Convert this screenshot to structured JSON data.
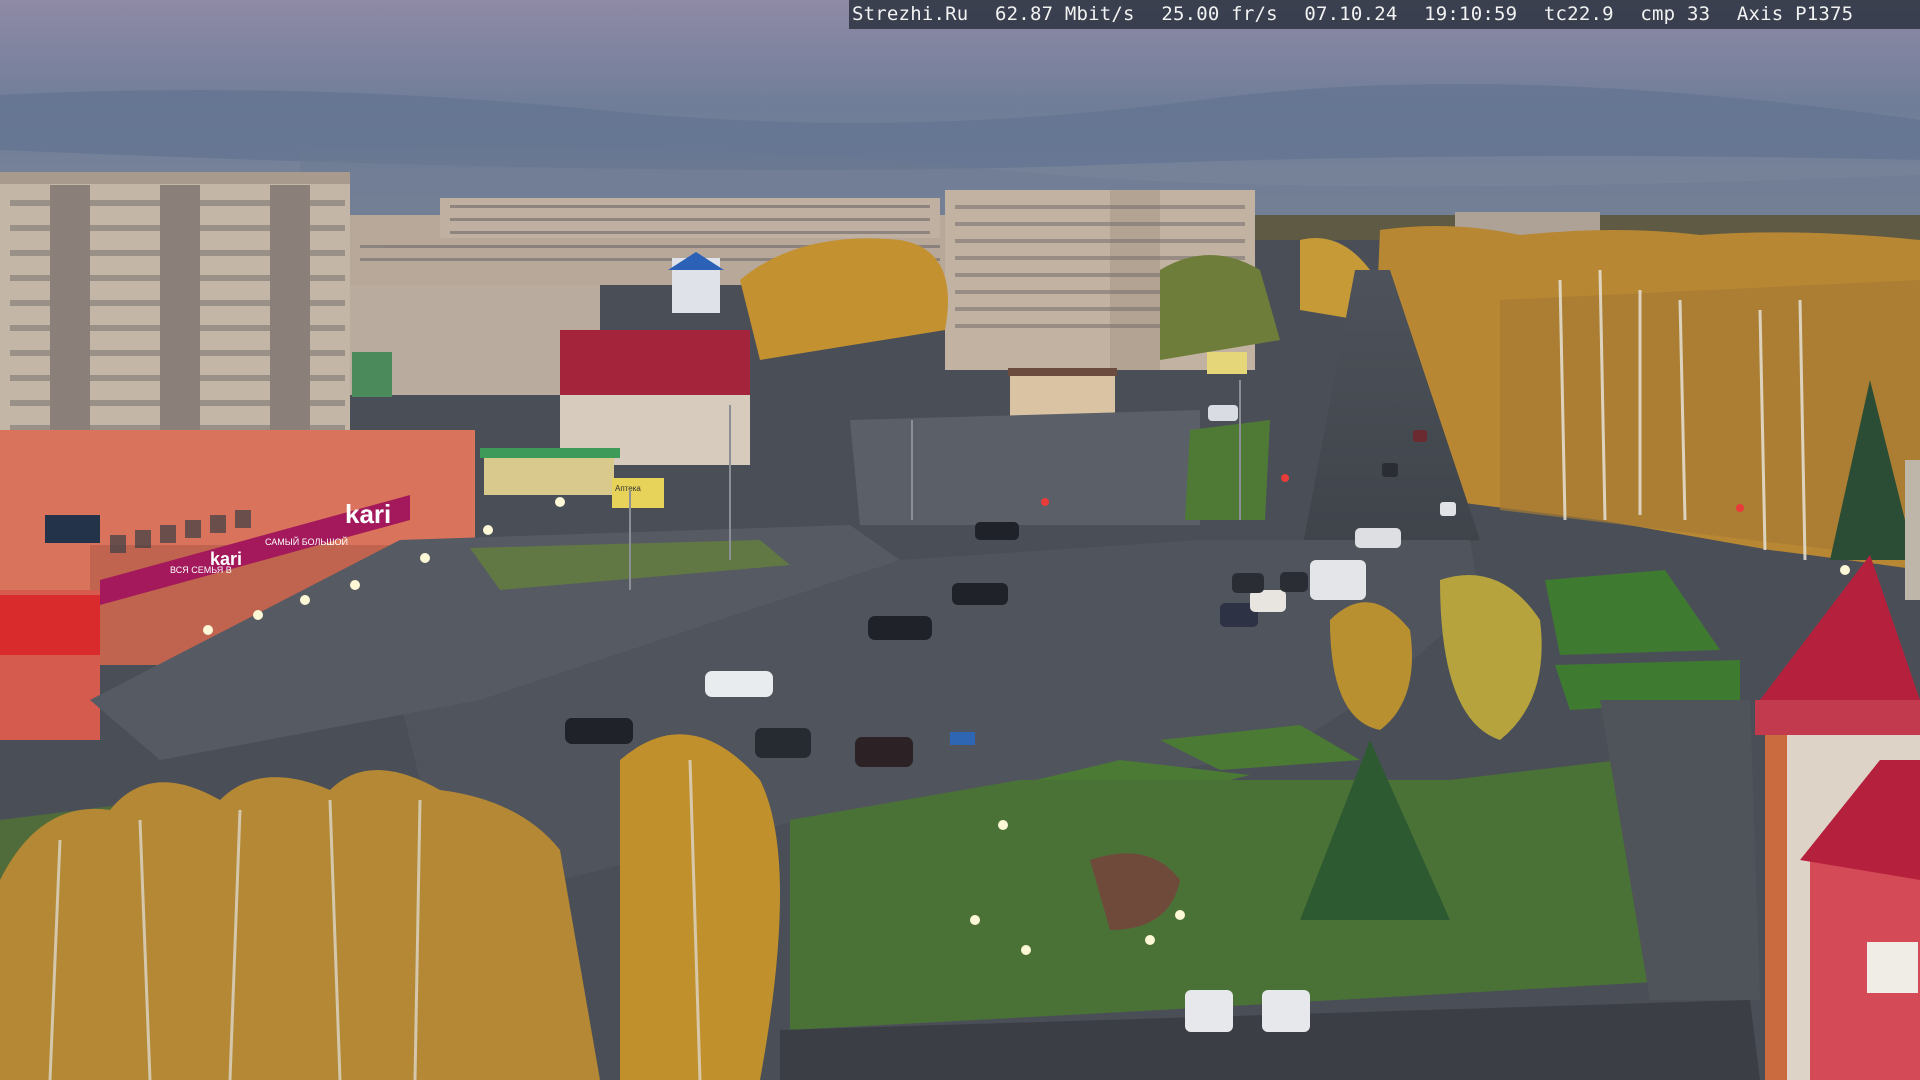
{
  "overlay": {
    "site": "Strezhi.Ru",
    "bitrate": "62.87 Mbit/s",
    "framerate": "25.00 fr/s",
    "date": "07.10.24",
    "time": "19:10:59",
    "tc": "tc22.9",
    "cmp": "cmp 33",
    "camera": "Axis P1375"
  },
  "signs": {
    "store_brand": "kari",
    "store_brand_small": "kari",
    "store_tagline": "ВСЯ СЕМЬЯ В",
    "store_sub": "САМЫЙ БОЛЬШОЙ",
    "pharmacy": "Аптека"
  },
  "colors": {
    "sky_top": "#8e8fa8",
    "sky_bottom": "#5d6d86",
    "asphalt": "#4b5058",
    "grass": "#4e7a3a",
    "foliage": "#c98f2d",
    "kari_sign": "#a3195b",
    "red_roof": "#b3203a"
  }
}
